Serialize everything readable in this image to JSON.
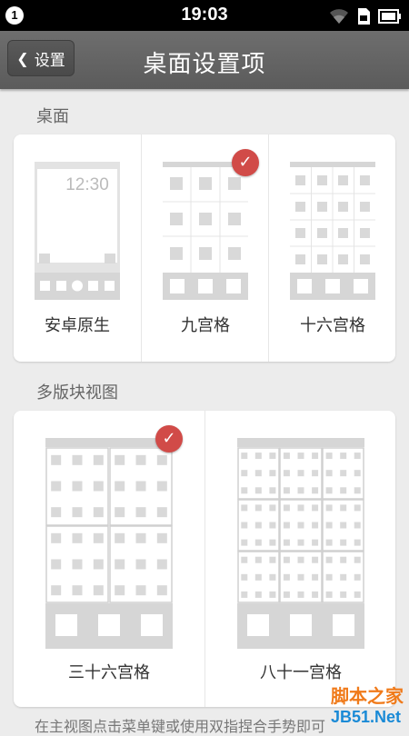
{
  "status_bar": {
    "notification_count": "1",
    "time": "19:03",
    "icons": [
      "wifi-icon",
      "sim-icon",
      "battery-icon"
    ]
  },
  "title_bar": {
    "back_label": "设置",
    "title": "桌面设置项"
  },
  "sections": [
    {
      "title": "桌面",
      "options": [
        {
          "label": "安卓原生",
          "preview_time": "12:30",
          "selected": false
        },
        {
          "label": "九宫格",
          "selected": true
        },
        {
          "label": "十六宫格",
          "selected": false
        }
      ]
    },
    {
      "title": "多版块视图",
      "options": [
        {
          "label": "三十六宫格",
          "selected": true
        },
        {
          "label": "八十一宫格",
          "selected": false
        }
      ]
    }
  ],
  "footnote": "在主视图点击菜单键或使用双指捏合手势即可",
  "watermark": {
    "text": "脚本之家",
    "url": "JB51.Net"
  },
  "colors": {
    "check": "#d14b48",
    "titlebar": "#666666",
    "background": "#ececec"
  }
}
